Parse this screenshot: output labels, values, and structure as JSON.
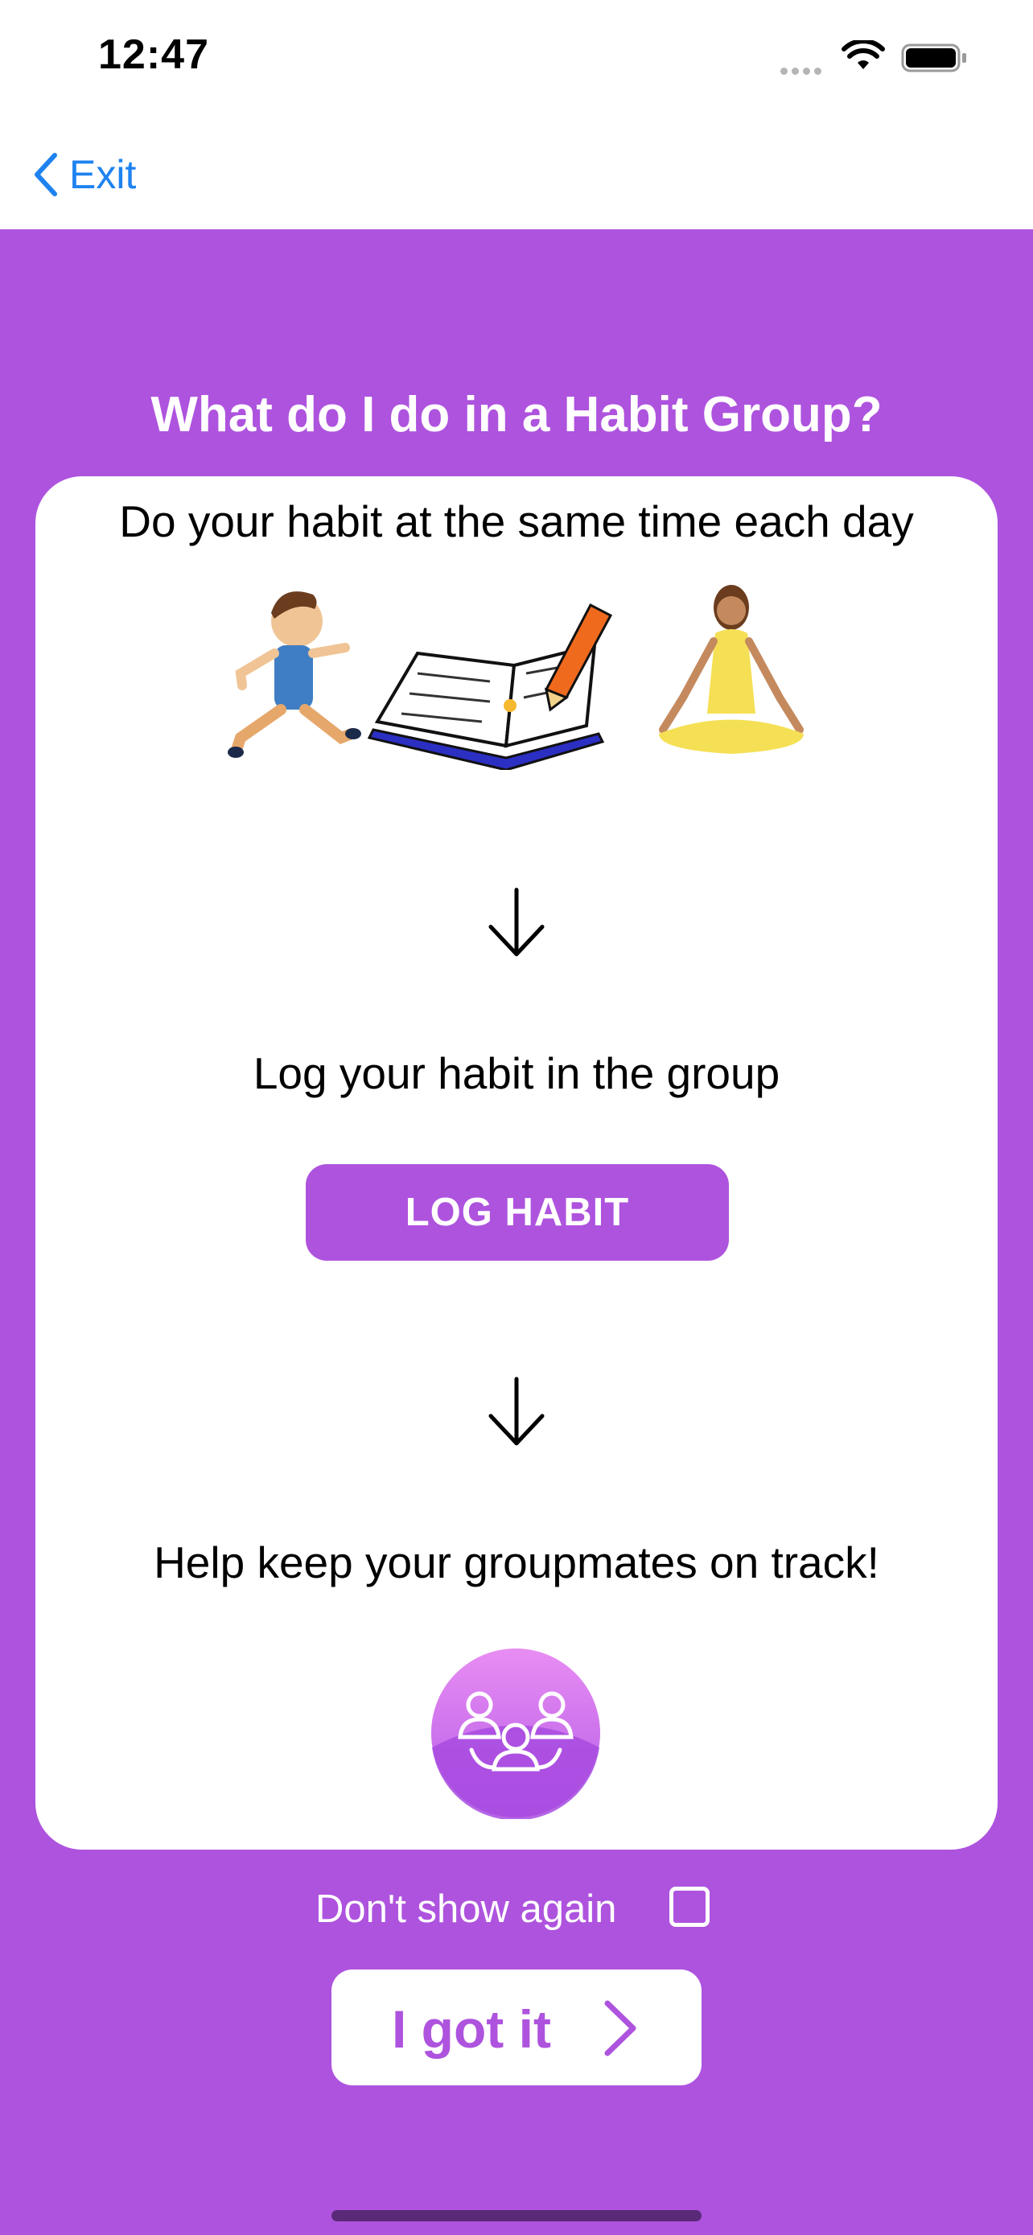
{
  "status_bar": {
    "time": "12:47"
  },
  "nav": {
    "back_label": "Exit"
  },
  "page": {
    "title": "What do I do in a Habit Group?"
  },
  "steps": [
    {
      "text": "Do your habit at the same time each day"
    },
    {
      "text": "Log your habit in the group",
      "button_label": "LOG HABIT"
    },
    {
      "text": "Help keep your groupmates on track!"
    }
  ],
  "footer": {
    "dont_show_label": "Don't show again",
    "dont_show_checked": false,
    "got_it_label": "I got it"
  },
  "icons": [
    "back-chevron-icon",
    "down-arrow-icon",
    "group-icon",
    "chevron-right-icon",
    "wifi-icon",
    "battery-icon"
  ],
  "colors": {
    "accent": "#ae53de",
    "link": "#1e82f0",
    "background": "#ffffff"
  }
}
